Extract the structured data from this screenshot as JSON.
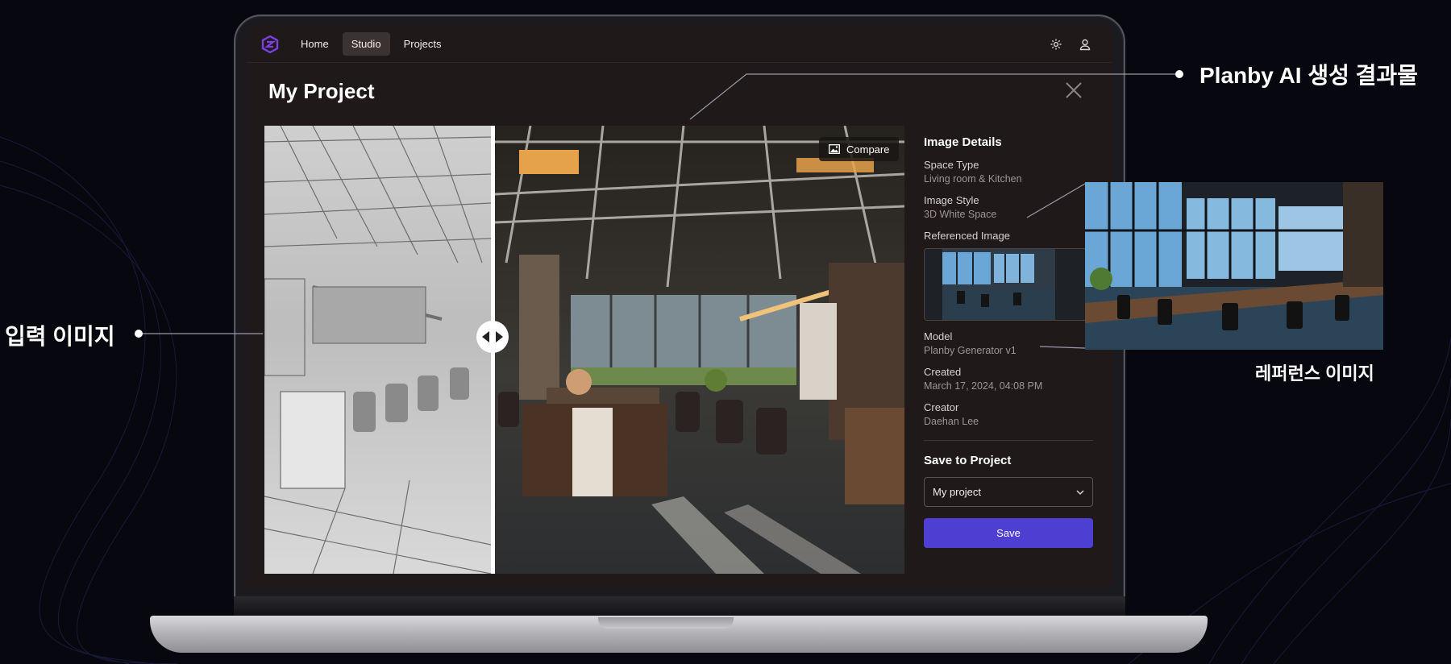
{
  "nav": {
    "items": [
      {
        "label": "Home"
      },
      {
        "label": "Studio"
      },
      {
        "label": "Projects"
      }
    ],
    "active_index": 1
  },
  "page": {
    "title": "My Project"
  },
  "compare": {
    "button_label": "Compare",
    "divider_position": 0.36
  },
  "details": {
    "heading": "Image Details",
    "fields": [
      {
        "label": "Space Type",
        "value": "Living room & Kitchen"
      },
      {
        "label": "Image Style",
        "value": "3D White Space"
      },
      {
        "label": "Referenced Image",
        "value": ""
      },
      {
        "label": "Model",
        "value": "Planby Generator v1"
      },
      {
        "label": "Created",
        "value": "March 17, 2024, 04:08 PM"
      },
      {
        "label": "Creator",
        "value": "Daehan Lee"
      }
    ]
  },
  "save": {
    "heading": "Save to Project",
    "selected_project": "My project",
    "button_label": "Save"
  },
  "callouts": {
    "result": "Planby AI 생성 결과물",
    "input": "입력 이미지",
    "reference": "레퍼런스 이미지"
  },
  "colors": {
    "accent": "#4d3fd1",
    "logo": "#7b3fe4",
    "background": "#07070f",
    "app_bg": "#1f1a19"
  }
}
